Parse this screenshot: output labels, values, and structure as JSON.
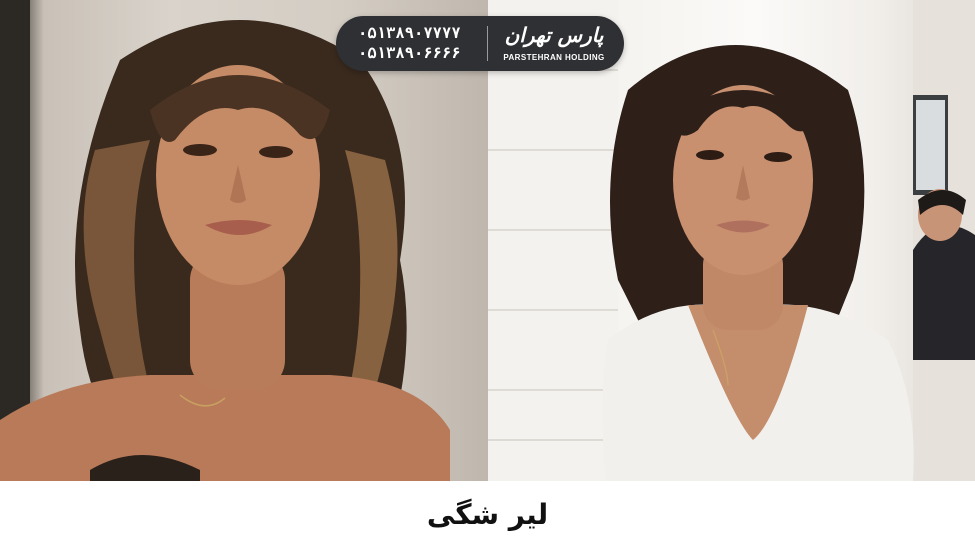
{
  "brand": {
    "phones": [
      "۰۵۱۳۸۹۰۷۷۷۷",
      "۰۵۱۳۸۹۰۶۶۶۶"
    ],
    "logo_text": "پارس تهران",
    "name_en": "PARSTEHRAN HOLDING"
  },
  "caption": "لیر شگی",
  "colors": {
    "badge_bg": "#2f3033",
    "badge_text": "#ffffff",
    "caption_text": "#111111",
    "page_bg": "#ffffff"
  }
}
